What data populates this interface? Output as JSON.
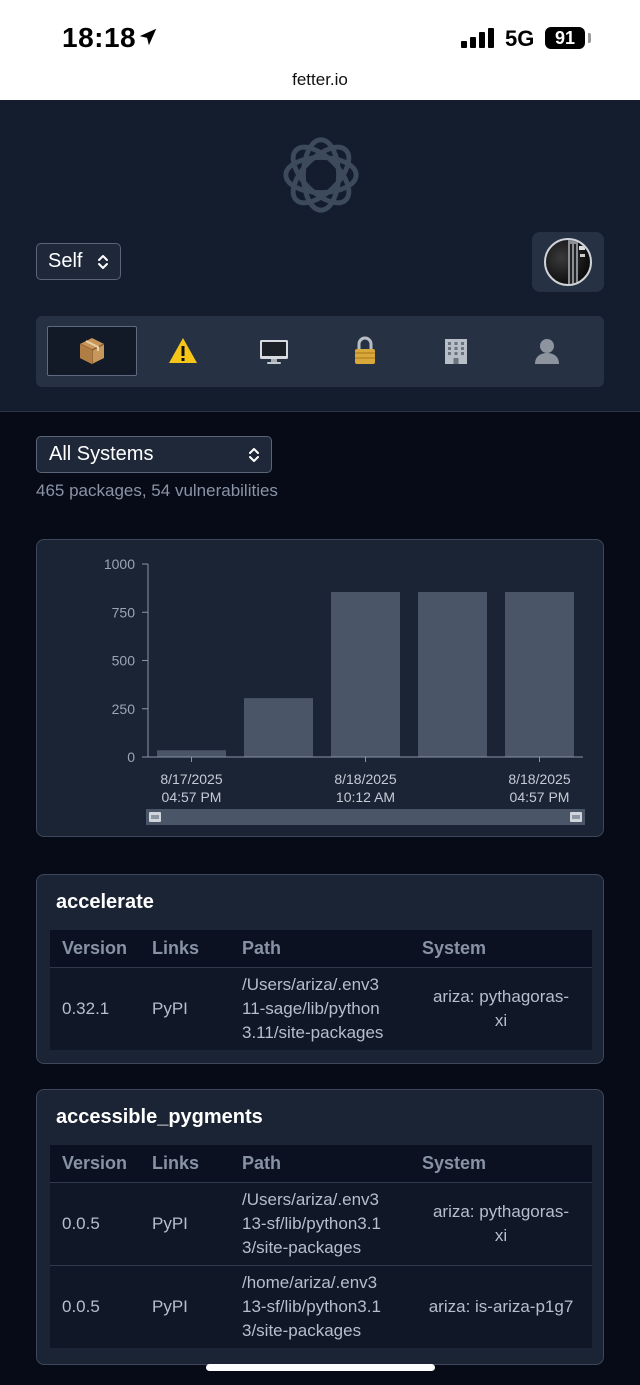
{
  "status_bar": {
    "time": "18:18",
    "network": "5G",
    "battery": "91",
    "url": "fetter.io"
  },
  "header": {
    "scope_select": "Self",
    "nav": [
      {
        "icon": "package-icon",
        "active": true
      },
      {
        "icon": "warning-icon",
        "active": false
      },
      {
        "icon": "computer-icon",
        "active": false
      },
      {
        "icon": "lock-icon",
        "active": false
      },
      {
        "icon": "office-building-icon",
        "active": false
      },
      {
        "icon": "person-silhouette-icon",
        "active": false
      }
    ]
  },
  "filter": {
    "systems_select": "All Systems",
    "summary": "465 packages, 54 vulnerabilities"
  },
  "chart_data": {
    "type": "bar",
    "categories": [
      "8/17/2025 04:57 PM",
      "",
      "8/18/2025 10:12 AM",
      "",
      "8/18/2025 04:57 PM"
    ],
    "values": [
      35,
      305,
      855,
      855,
      855
    ],
    "yticks": [
      "0",
      "250",
      "500",
      "750",
      "1000"
    ],
    "ylim": [
      0,
      1000
    ],
    "xtick_labels": [
      {
        "date": "8/17/2025",
        "time": "04:57 PM"
      },
      {
        "date": "8/18/2025",
        "time": "10:12 AM"
      },
      {
        "date": "8/18/2025",
        "time": "04:57 PM"
      }
    ],
    "bar_color": "#4a5568"
  },
  "table_headers": {
    "version": "Version",
    "links": "Links",
    "path": "Path",
    "system": "System"
  },
  "packages": [
    {
      "name": "accelerate",
      "rows": [
        {
          "version": "0.32.1",
          "link": "PyPI",
          "path": [
            "/Users/ariza/.env3",
            "11-sage/lib/python",
            "3.11/site-packages"
          ],
          "system": [
            "ariza: pythagoras-",
            "xi"
          ]
        }
      ]
    },
    {
      "name": "accessible_pygments",
      "rows": [
        {
          "version": "0.0.5",
          "link": "PyPI",
          "path": [
            "/Users/ariza/.env3",
            "13-sf/lib/python3.1",
            "3/site-packages"
          ],
          "system": [
            "ariza: pythagoras-",
            "xi"
          ]
        },
        {
          "version": "0.0.5",
          "link": "PyPI",
          "path": [
            "/home/ariza/.env3",
            "13-sf/lib/python3.1",
            "3/site-packages"
          ],
          "system": [
            "ariza: is-ariza-p1g7"
          ]
        }
      ]
    }
  ]
}
